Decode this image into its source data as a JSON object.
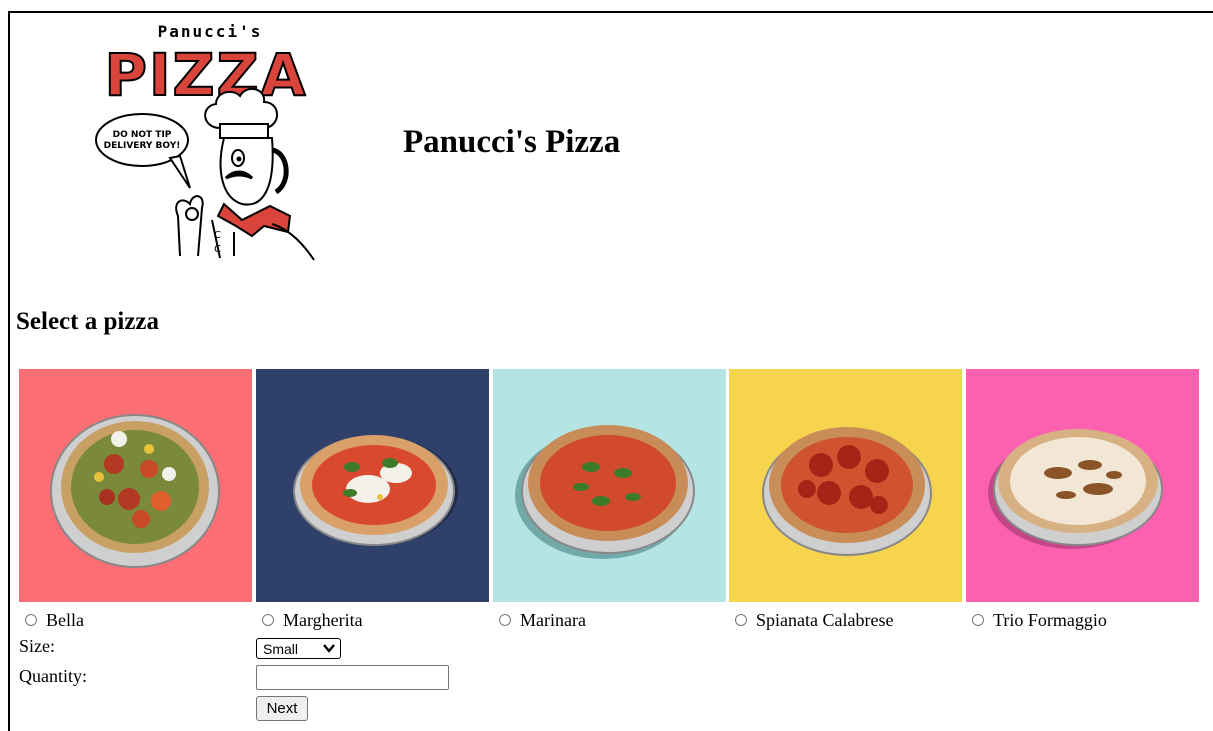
{
  "header": {
    "logo": {
      "top_text": "Panucci's",
      "word": "PIZZA",
      "bubble_line1": "DO NOT TIP",
      "bubble_line2": "DELIVERY BOY!"
    },
    "title": "Panucci's Pizza"
  },
  "main": {
    "heading": "Select a pizza",
    "pizzas": [
      {
        "label": "Bella",
        "bg": "#fb6e73"
      },
      {
        "label": "Margherita",
        "bg": "#2f406a"
      },
      {
        "label": "Marinara",
        "bg": "#b4e4e4"
      },
      {
        "label": "Spianata Calabrese",
        "bg": "#f6d44e"
      },
      {
        "label": "Trio Formaggio",
        "bg": "#fc61b0"
      }
    ]
  },
  "form": {
    "size_label": "Size:",
    "size_value": "Small",
    "quantity_label": "Quantity:",
    "quantity_value": "",
    "next_label": "Next"
  },
  "colors": {
    "logo_red": "#d9443b",
    "border": "#000000"
  }
}
